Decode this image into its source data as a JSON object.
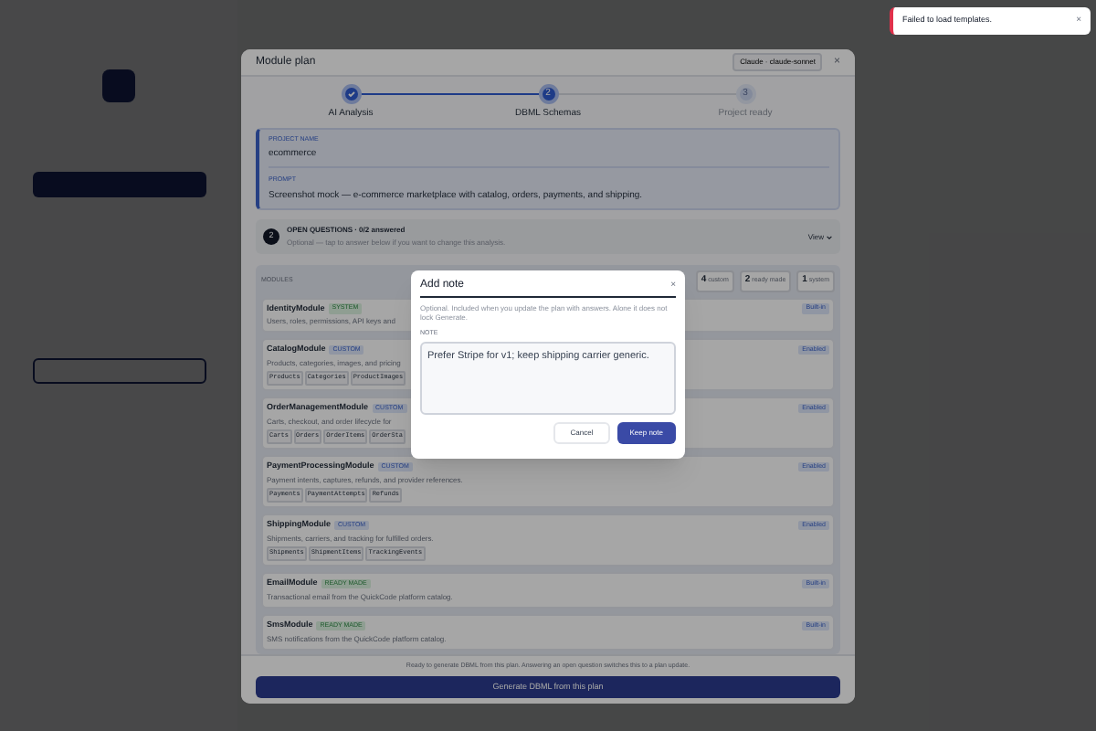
{
  "toast": {
    "message": "Failed to load templates.",
    "close": "×"
  },
  "modal": {
    "title": "Module plan",
    "model_badge": "Claude · claude-sonnet",
    "close": "×",
    "steps": [
      {
        "label": "AI Analysis",
        "kind": "done"
      },
      {
        "label": "DBML Schemas",
        "kind": "current",
        "number": "2"
      },
      {
        "label": "Project ready",
        "kind": "pending",
        "number": "3"
      }
    ],
    "project": {
      "name_label": "PROJECT NAME",
      "name": "ecommerce",
      "prompt_label": "PROMPT",
      "prompt": "Screenshot mock — e-commerce marketplace with catalog, orders, payments, and shipping."
    },
    "questions": {
      "count": "2",
      "title": "OPEN QUESTIONS · 0/2 answered",
      "hint": "Optional — tap to answer below if you want to change this analysis.",
      "view": "View"
    },
    "modules_label": "MODULES",
    "counts": [
      {
        "number": "4",
        "label": "custom"
      },
      {
        "number": "2",
        "label": "ready made"
      },
      {
        "number": "1",
        "label": "system"
      }
    ],
    "modules": [
      {
        "name": "IdentityModule",
        "tag": "SYSTEM",
        "kind": "system",
        "description": "Users, roles, permissions, API keys and",
        "status": "Built-in"
      },
      {
        "name": "CatalogModule",
        "tag": "CUSTOM",
        "kind": "custom",
        "description": "Products, categories, images, and pricing",
        "status": "Enabled",
        "tables": [
          "Products",
          "Categories",
          "ProductImages"
        ]
      },
      {
        "name": "OrderManagementModule",
        "tag": "CUSTOM",
        "kind": "custom",
        "description": "Carts, checkout, and order lifecycle for",
        "status": "Enabled",
        "tables": [
          "Carts",
          "Orders",
          "OrderItems",
          "OrderSta"
        ]
      },
      {
        "name": "PaymentProcessingModule",
        "tag": "CUSTOM",
        "kind": "custom",
        "description": "Payment intents, captures, refunds, and provider references.",
        "status": "Enabled",
        "tables": [
          "Payments",
          "PaymentAttempts",
          "Refunds"
        ]
      },
      {
        "name": "ShippingModule",
        "tag": "CUSTOM",
        "kind": "custom",
        "description": "Shipments, carriers, and tracking for fulfilled orders.",
        "status": "Enabled",
        "tables": [
          "Shipments",
          "ShipmentItems",
          "TrackingEvents"
        ]
      },
      {
        "name": "EmailModule",
        "tag": "READY MADE",
        "kind": "ready",
        "description": "Transactional email from the QuickCode platform catalog.",
        "status": "Built-in"
      },
      {
        "name": "SmsModule",
        "tag": "READY MADE",
        "kind": "ready",
        "description": "SMS notifications from the QuickCode platform catalog.",
        "status": "Built-in"
      }
    ],
    "footer_note": "Ready to generate DBML from this plan. Answering an open question switches this to a plan update.",
    "generate_button": "Generate DBML from this plan"
  },
  "dialog": {
    "title": "Add note",
    "close": "×",
    "hint": "Optional. Included when you update the plan with answers. Alone it does not lock Generate.",
    "field_label": "NOTE",
    "value": "Prefer Stripe for v1; keep shipping carrier generic.",
    "cancel": "Cancel",
    "confirm": "Keep note"
  }
}
